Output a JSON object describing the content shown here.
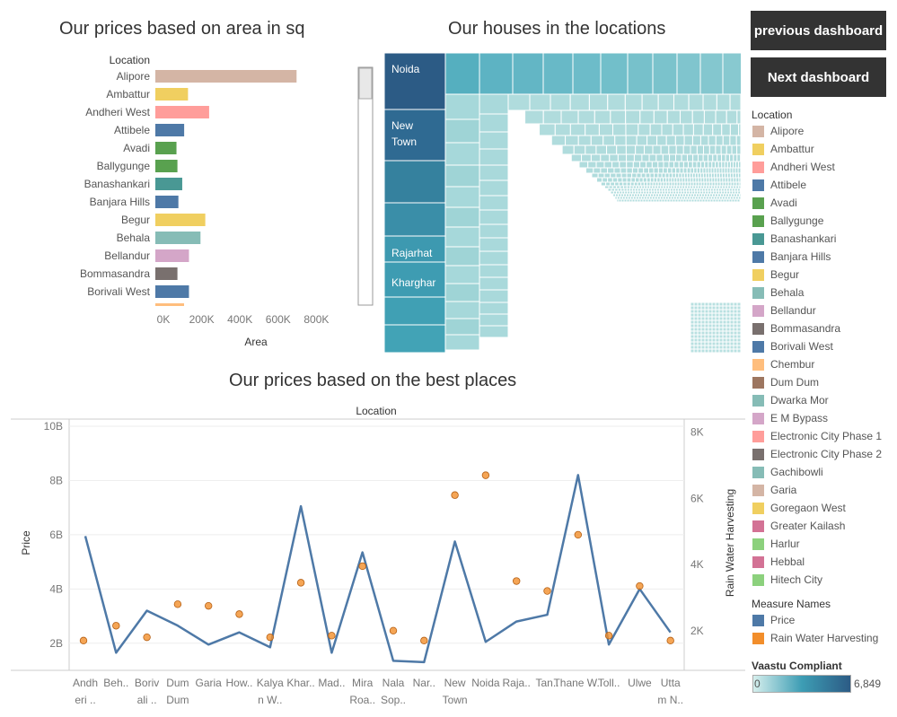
{
  "titles": {
    "area_chart": "Our prices based on area in sq",
    "treemap": "Our houses in the locations",
    "line_chart": "Our prices based on the best places"
  },
  "buttons": {
    "previous": "previous dashboard",
    "next": "Next dashboard"
  },
  "legend": {
    "location_title": "Location",
    "locations": [
      {
        "name": "Alipore",
        "color": "#d4b5a5"
      },
      {
        "name": "Ambattur",
        "color": "#f0cf60"
      },
      {
        "name": "Andheri West",
        "color": "#ff9d9a"
      },
      {
        "name": "Attibele",
        "color": "#4e79a7"
      },
      {
        "name": "Avadi",
        "color": "#59a14f"
      },
      {
        "name": "Ballygunge",
        "color": "#59a14f"
      },
      {
        "name": "Banashankari",
        "color": "#499894"
      },
      {
        "name": "Banjara Hills",
        "color": "#4e79a7"
      },
      {
        "name": "Begur",
        "color": "#f0cf60"
      },
      {
        "name": "Behala",
        "color": "#86bcb6"
      },
      {
        "name": "Bellandur",
        "color": "#d4a6c8"
      },
      {
        "name": "Bommasandra",
        "color": "#79706e"
      },
      {
        "name": "Borivali West",
        "color": "#4e79a7"
      },
      {
        "name": "Chembur",
        "color": "#ffbe7d"
      },
      {
        "name": "Dum Dum",
        "color": "#9d7660"
      },
      {
        "name": "Dwarka Mor",
        "color": "#86bcb6"
      },
      {
        "name": "E M Bypass",
        "color": "#d4a6c8"
      },
      {
        "name": "Electronic City Phase 1",
        "color": "#ff9d9a"
      },
      {
        "name": "Electronic City Phase 2",
        "color": "#79706e"
      },
      {
        "name": "Gachibowli",
        "color": "#86bcb6"
      },
      {
        "name": "Garia",
        "color": "#d4b5a5"
      },
      {
        "name": "Goregaon West",
        "color": "#f0cf60"
      },
      {
        "name": "Greater Kailash",
        "color": "#d37295"
      },
      {
        "name": "Harlur",
        "color": "#8cd17d"
      },
      {
        "name": "Hebbal",
        "color": "#d37295"
      },
      {
        "name": "Hitech City",
        "color": "#8cd17d"
      }
    ],
    "measure_title": "Measure Names",
    "measures": [
      {
        "name": "Price",
        "color": "#4e79a7"
      },
      {
        "name": "Rain Water Harvesting",
        "color": "#f28e2b"
      }
    ],
    "vaastu_title": "Vaastu Compliant",
    "vaastu_min": "0",
    "vaastu_max": "6,849"
  },
  "chart_data": [
    {
      "type": "bar",
      "title": "Our prices based on area in sq",
      "category_header": "Location",
      "xlabel": "Area",
      "ylabel": "",
      "xlim": [
        0,
        900000
      ],
      "xticks": [
        "0K",
        "200K",
        "400K",
        "600K",
        "800K"
      ],
      "categories": [
        "Alipore",
        "Ambattur",
        "Andheri West",
        "Attibele",
        "Avadi",
        "Ballygunge",
        "Banashankari",
        "Banjara Hills",
        "Begur",
        "Behala",
        "Bellandur",
        "Bommasandra",
        "Borivali West"
      ],
      "values": [
        735000,
        170000,
        280000,
        150000,
        110000,
        115000,
        140000,
        120000,
        260000,
        235000,
        175000,
        115000,
        175000
      ],
      "colors": [
        "#d4b5a5",
        "#f0cf60",
        "#ff9d9a",
        "#4e79a7",
        "#59a14f",
        "#59a14f",
        "#499894",
        "#4e79a7",
        "#f0cf60",
        "#86bcb6",
        "#d4a6c8",
        "#79706e",
        "#4e79a7"
      ]
    },
    {
      "type": "treemap",
      "title": "Our houses in the locations",
      "labels": [
        "Noida",
        "New Town",
        "Rajarhat",
        "Kharghar"
      ],
      "color_range": [
        0,
        6849
      ]
    },
    {
      "type": "line",
      "title": "Our prices based on the best places",
      "xlabel": "Location",
      "ylabel": "Price",
      "y2label": "Rain Water Harvesting",
      "ylim": [
        1000000000,
        10000000000
      ],
      "yticks": [
        "2B",
        "4B",
        "6B",
        "8B",
        "10B"
      ],
      "y2lim": [
        800,
        8400
      ],
      "y2ticks": [
        "2K",
        "4K",
        "6K",
        "8K"
      ],
      "categories": [
        [
          "Andh",
          "eri .."
        ],
        [
          "Beh.."
        ],
        [
          "Boriv",
          "ali .."
        ],
        [
          "Dum",
          "Dum"
        ],
        [
          "Garia"
        ],
        [
          "How.."
        ],
        [
          "Kalya",
          "n W.."
        ],
        [
          "Khar.."
        ],
        [
          "Mad.."
        ],
        [
          "Mira",
          "Roa.."
        ],
        [
          "Nala",
          "Sop.."
        ],
        [
          "Nar.."
        ],
        [
          "New",
          "Town"
        ],
        [
          "Noida"
        ],
        [
          "Raja.."
        ],
        [
          "Tan.."
        ],
        [
          "Thane W.."
        ],
        [
          "Toll.."
        ],
        [
          "Ulwe"
        ],
        [
          "Utta",
          "m N.."
        ]
      ],
      "series": [
        {
          "name": "Price",
          "color": "#4e79a7",
          "axis": "left",
          "values": [
            5950000000,
            1650000000,
            3200000000,
            2650000000,
            1950000000,
            2400000000,
            1850000000,
            7050000000,
            1650000000,
            5350000000,
            1350000000,
            1300000000,
            5750000000,
            2050000000,
            2800000000,
            3050000000,
            8200000000,
            1950000000,
            4000000000,
            2400000000
          ]
        },
        {
          "name": "Rain Water Harvesting",
          "color": "#f28e2b",
          "axis": "right",
          "values": [
            1700,
            2150,
            1800,
            2800,
            2750,
            2500,
            1800,
            3450,
            1850,
            3950,
            2000,
            1700,
            6100,
            6700,
            3500,
            3200,
            4900,
            1850,
            3350,
            1700
          ]
        }
      ]
    }
  ]
}
